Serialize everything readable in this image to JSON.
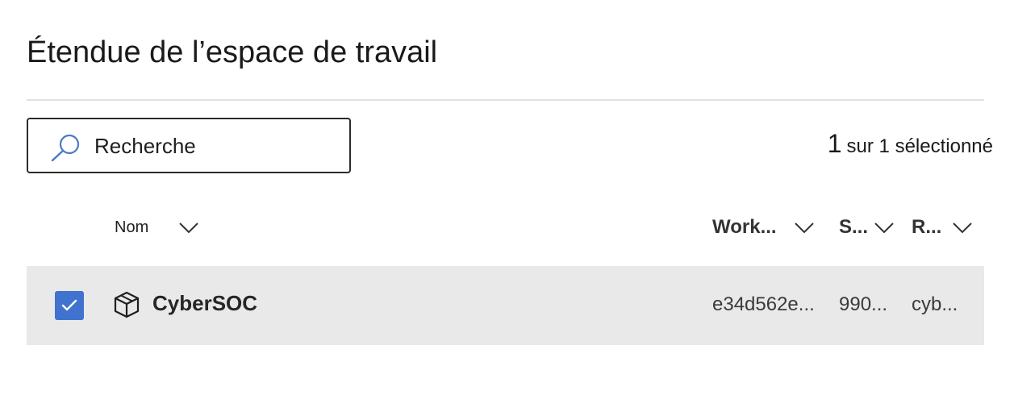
{
  "page": {
    "title": "Étendue de l’espace de travail"
  },
  "search": {
    "placeholder": "Recherche"
  },
  "selection": {
    "count": "1",
    "text": "sur 1 sélectionné"
  },
  "columns": [
    {
      "label": "Nom"
    },
    {
      "label": "Work..."
    },
    {
      "label": "S..."
    },
    {
      "label": "R..."
    }
  ],
  "rows": [
    {
      "selected": true,
      "name": "CyberSOC",
      "workspace": "e34d562e...",
      "subscription": "990...",
      "resource_group": "cyb..."
    }
  ],
  "icons": {
    "search": "search-icon",
    "chevron": "chevron-down-icon",
    "checkbox": "checkmark-icon",
    "workspace": "cube-icon"
  },
  "colors": {
    "accent": "#3f73cf",
    "row_selected_bg": "#e9e9e9"
  }
}
